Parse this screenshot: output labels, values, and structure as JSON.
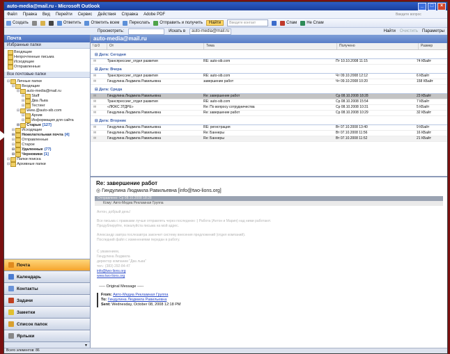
{
  "window": {
    "title": "auto-media@mail.ru - Microsoft Outlook"
  },
  "menu": {
    "items": [
      "Файл",
      "Правка",
      "Вид",
      "Перейти",
      "Сервис",
      "Действия",
      "Справка",
      "Adobe PDF"
    ],
    "help_placeholder": "Введите вопрос"
  },
  "toolbar": {
    "create": "Создать",
    "reply_sender": "Ответить",
    "reply_all": "Ответить всем",
    "forward": "Переслать",
    "send_receive": "Отправить и получить",
    "find": "Найти",
    "search_placeholder": "Введите контакт",
    "spam": "Спам",
    "not_spam": "Не Спам"
  },
  "toolbar2": {
    "view": "Просмотреть:",
    "search_in": "Искать в",
    "account": "auto-media@mail.ru",
    "find": "Найти",
    "clear": "Очистить",
    "params": "Параметры"
  },
  "nav": {
    "header": "Почта",
    "favorites_title": "Избранные папки",
    "favorites": [
      "Входящие",
      "Непрочтенные письма",
      "Исходящие",
      "Отправленные"
    ],
    "all_title": "Все почтовые папки",
    "tree": [
      {
        "label": "Личные папки",
        "level": 0,
        "bold": false,
        "count": ""
      },
      {
        "label": "Входящие",
        "level": 1,
        "bold": false,
        "count": ""
      },
      {
        "label": "auto-media@mail.ru",
        "level": 2,
        "bold": false,
        "count": ""
      },
      {
        "label": "Staff",
        "level": 3,
        "bold": false,
        "count": ""
      },
      {
        "label": "Два Льва",
        "level": 3,
        "bold": false,
        "count": ""
      },
      {
        "label": "Тестинг",
        "level": 3,
        "bold": false,
        "count": ""
      },
      {
        "label": "www.@auto-sib.com",
        "level": 2,
        "bold": false,
        "count": ""
      },
      {
        "label": "Архив",
        "level": 3,
        "bold": false,
        "count": ""
      },
      {
        "label": "Информация для сайта",
        "level": 3,
        "bold": false,
        "count": ""
      },
      {
        "label": "Старые",
        "level": 2,
        "bold": true,
        "count": "[127]"
      },
      {
        "label": "Исходящие",
        "level": 1,
        "bold": false,
        "count": ""
      },
      {
        "label": "Нежелательная почта",
        "level": 1,
        "bold": true,
        "count": "[4]"
      },
      {
        "label": "Отправленные",
        "level": 1,
        "bold": false,
        "count": ""
      },
      {
        "label": "Старое",
        "level": 1,
        "bold": false,
        "count": ""
      },
      {
        "label": "Удаленные",
        "level": 1,
        "bold": true,
        "count": "(77)"
      },
      {
        "label": "Черновики",
        "level": 1,
        "bold": true,
        "count": "[1]"
      },
      {
        "label": "Папки поиска",
        "level": 0,
        "bold": false,
        "count": ""
      },
      {
        "label": "Архивные папки",
        "level": 0,
        "bold": false,
        "count": ""
      }
    ],
    "buttons": [
      {
        "label": "Почта",
        "active": true,
        "color": "#e08a1e"
      },
      {
        "label": "Календарь",
        "active": false,
        "color": "#4a7bd0"
      },
      {
        "label": "Контакты",
        "active": false,
        "color": "#6a93d8"
      },
      {
        "label": "Задачи",
        "active": false,
        "color": "#c04020"
      },
      {
        "label": "Заметки",
        "active": false,
        "color": "#e0c030"
      },
      {
        "label": "Список папок",
        "active": false,
        "color": "#d8a030"
      },
      {
        "label": "Ярлыки",
        "active": false,
        "color": "#888888"
      }
    ]
  },
  "mail": {
    "header": "auto-media@mail.ru",
    "columns": {
      "from": "От",
      "subject": "Тема",
      "received": "Получено",
      "size": "Размер"
    },
    "groups": [
      {
        "title": "Дата: Сегодня",
        "rows": [
          {
            "from": "Транспрессинг_отдел развития",
            "subject": "RE: auto-sib.com",
            "date": "Пт 10.10.2008 11:15",
            "size": "74 КБайт",
            "state": "normal"
          }
        ]
      },
      {
        "title": "Дата: Вчера",
        "rows": [
          {
            "from": "Транспрессинг_отдел развития",
            "subject": "RE: auto-sib.com",
            "date": "Чт 09.10.2008 12:12",
            "size": "6 КБайт",
            "state": "normal"
          },
          {
            "from": "Гиндулина Людмила Равильевна",
            "subject": "завершение работ",
            "date": "Чт 09.10.2008 10:20",
            "size": "158 КБайт",
            "state": "normal"
          }
        ]
      },
      {
        "title": "Дата: Среда",
        "rows": [
          {
            "from": "Гиндулина Людмила Равильевна",
            "subject": "Re: завершение работ",
            "date": "Ср 08.10.2008 18:28",
            "size": "23 КБайт",
            "state": "selected"
          },
          {
            "from": "Транспрессинг_отдел развития",
            "subject": "RE: auto-sib.com",
            "date": "Ср 08.10.2008 15:54",
            "size": "7 КБайт",
            "state": "normal"
          },
          {
            "from": "«ЛЮКС ЗТДРЕ»",
            "subject": "Re: По вопросу сотрудничества",
            "date": "Ср 08.10.2008 10:31",
            "size": "5 КБайт",
            "state": "normal"
          },
          {
            "from": "Гиндулина Людмила Равильевна",
            "subject": "Re: завершение работ",
            "date": "Ср 08.10.2008 10:29",
            "size": "32 КБайт",
            "state": "normal"
          }
        ]
      },
      {
        "title": "Дата: Вторник",
        "rows": [
          {
            "from": "Гиндулина Людмила Равильевна",
            "subject": "RE: регистрация",
            "date": "Вт 07.10.2008 13:40",
            "size": "9 КБайт",
            "state": "normal"
          },
          {
            "from": "Гиндулина Людмила Равильевна",
            "subject": "Re: Баннеры",
            "date": "Вт 07.10.2008 11:56",
            "size": "16 КБайт",
            "state": "normal"
          },
          {
            "from": "Гиндулина Людмила Равильевна",
            "subject": "Re: Баннеры",
            "date": "Вт 07.10.2008 11:52",
            "size": "21 КБайт",
            "state": "highlight"
          }
        ]
      }
    ]
  },
  "reading": {
    "subject": "Re: завершение работ",
    "from": "Гиндулина Людмила Равильевна [info@two-lions.org]",
    "sent_label": "Отправлено: Ср 08.10.2008 18:28",
    "to_label": "Кому: Авто-Медиа Рекламная Группа",
    "greeting": "Антон, добрый день!",
    "p1": "Все письма с правками лучше отправлять через последнюю :) Работа (Антон и Мария) над ними работают.",
    "p1b": "Продублируйте, пожалуйста письма на мой адрес.",
    "p2": "Александр завтра послезавтра закончит систему внесения предложений (отдел компаний).",
    "p2b": "Последний файл с изменениями передан в работу.",
    "sig": [
      "С уважением,",
      "Гиндулина Людмила",
      "директор компании \"Два льва\"",
      "тел.: (383) 292-84-47"
    ],
    "sig_email": "info@two-lions.org",
    "sig_site": "www.two-lions.org",
    "orig_title": "----- Original Message -----",
    "orig_from_label": "From:",
    "orig_from": "Авто-Медиа Рекламная Группа",
    "orig_to_label": "To:",
    "orig_to": "Гиндулина Людмила Равильевна",
    "orig_sent_label": "Sent:",
    "orig_sent": "Wednesday, October 08, 2008 12:18 PM"
  },
  "status": {
    "text": "Всего элементов: 86"
  }
}
